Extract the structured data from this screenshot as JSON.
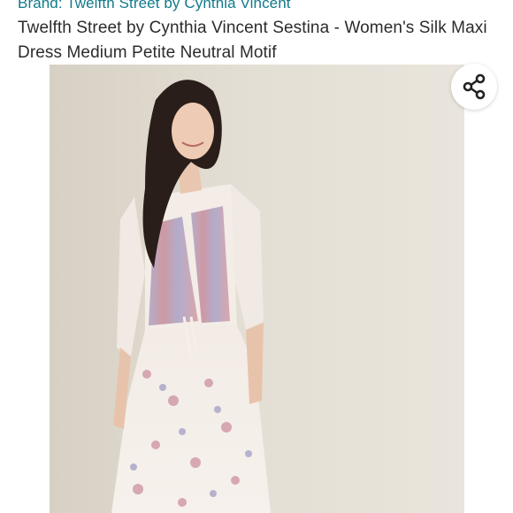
{
  "brand": {
    "prefix": "Brand: ",
    "name": "Twelfth Street by Cynthia Vincent"
  },
  "product": {
    "title": "Twelfth Street by Cynthia Vincent Sestina - Women's Silk Maxi Dress Medium Petite Neutral Motif"
  },
  "share": {
    "icon": "share-icon"
  },
  "colors": {
    "brand_link": "#117a8b",
    "title_text": "#2b2b2b",
    "background": "#ffffff"
  }
}
